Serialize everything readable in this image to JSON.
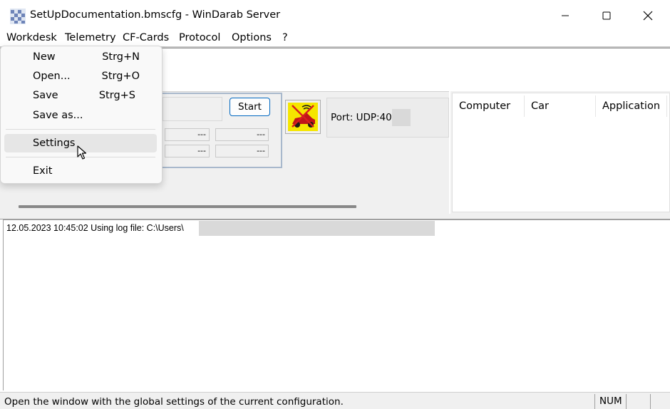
{
  "window": {
    "title": "SetUpDocumentation.bmscfg - WinDarab Server",
    "icons": {
      "app": "checkered-flag-icon",
      "minimize": "minimize-icon",
      "maximize": "maximize-icon",
      "close": "close-icon"
    }
  },
  "menubar": {
    "items": [
      {
        "label": "Workdesk"
      },
      {
        "label": "Telemetry"
      },
      {
        "label": "CF-Cards"
      },
      {
        "label": "Protocol"
      },
      {
        "label": "Options"
      },
      {
        "label": "?"
      }
    ]
  },
  "workdesk_menu": {
    "items": [
      {
        "label": "New",
        "shortcut": "Strg+N"
      },
      {
        "label": "Open...",
        "shortcut": "Strg+O"
      },
      {
        "label": "Save",
        "shortcut": "Strg+S"
      },
      {
        "label": "Save as...",
        "shortcut": ""
      },
      {
        "label": "Settings",
        "shortcut": ""
      },
      {
        "label": "Exit",
        "shortcut": ""
      }
    ],
    "highlighted": "Settings"
  },
  "connection": {
    "start_label": "Start",
    "fields": [
      "---",
      "---",
      "---",
      "---"
    ],
    "car_icon": "car-telemetry-disabled-icon",
    "port_label": "Port: UDP:400"
  },
  "client_list": {
    "columns": [
      "Computer",
      "Car",
      "Application"
    ]
  },
  "log": {
    "lines": [
      "12.05.2023 10:45:02 Using log file: C:\\Users\\"
    ]
  },
  "statusbar": {
    "message": "Open the window with the global settings of the current configuration.",
    "num": "NUM"
  },
  "colors": {
    "accent_border": "#0067c0",
    "car_icon_bg": "#f5e600",
    "car_icon_cross": "#d81e1e"
  }
}
